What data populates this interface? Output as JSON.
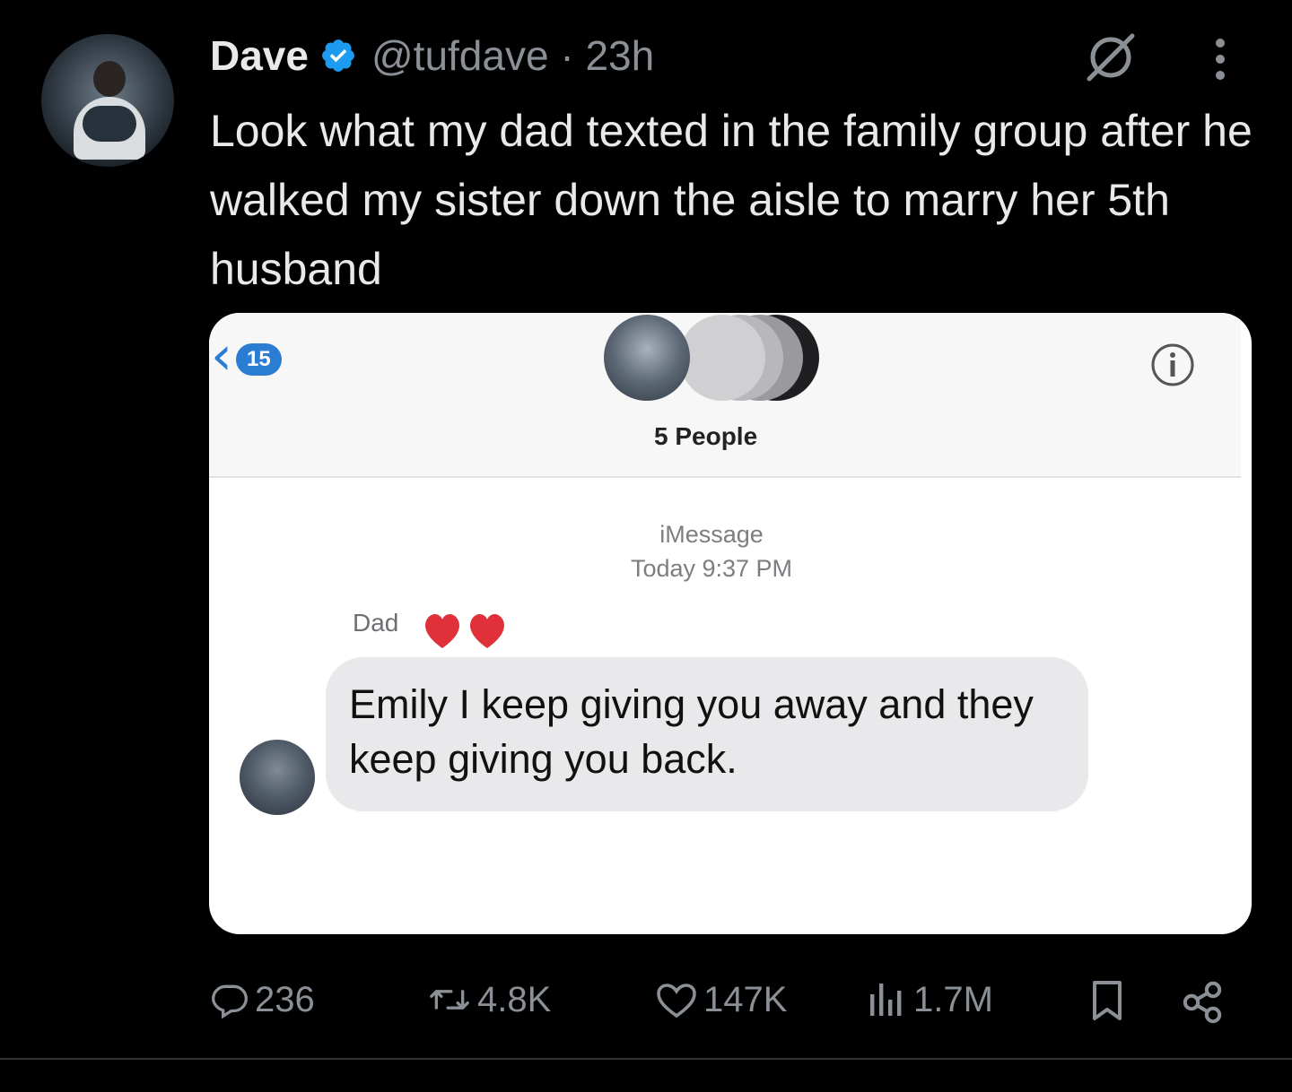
{
  "tweet": {
    "author_name": "Dave",
    "handle": "@tufdave",
    "separator": " · ",
    "time": "23h",
    "text": "Look what my dad texted in the family group after he walked my sister down the aisle to marry her 5th husband"
  },
  "screenshot": {
    "back_count": "15",
    "group_label": "5 People",
    "service": "iMessage",
    "timestamp": "Today 9:37 PM",
    "sender": "Dad",
    "message": "Emily I keep giving you away and they keep giving you back."
  },
  "actions": {
    "replies": "236",
    "reposts": "4.8K",
    "likes": "147K",
    "views": "1.7M"
  },
  "colors": {
    "background": "#000000",
    "text": "#e7e9ea",
    "muted": "#8b9096",
    "verified": "#1d9bf0",
    "imessage_blue": "#2b7cd3",
    "heart": "#e0303a"
  }
}
